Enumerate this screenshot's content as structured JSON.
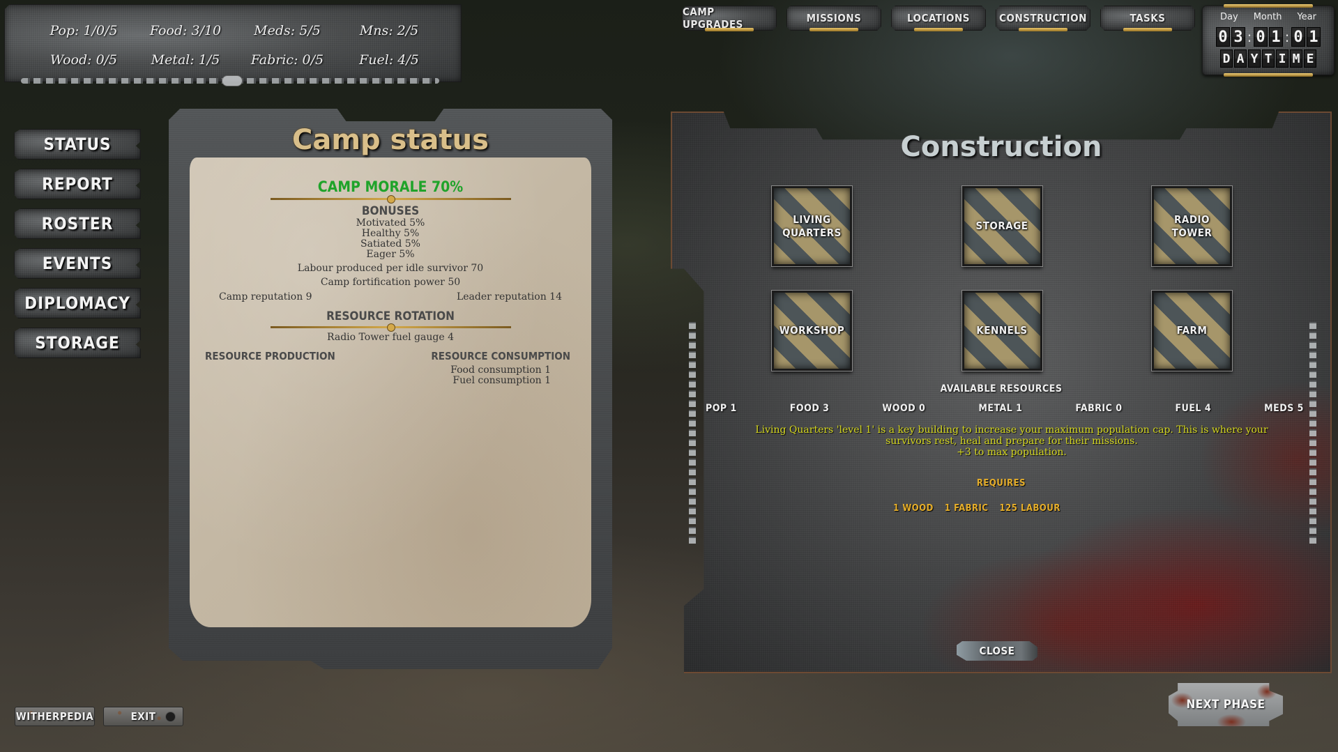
{
  "resource_bar": {
    "items": [
      {
        "label": "Pop: 1/0/5"
      },
      {
        "label": "Food: 3/10"
      },
      {
        "label": "Meds: 5/5"
      },
      {
        "label": "Mns: 2/5"
      },
      {
        "label": "Wood: 0/5"
      },
      {
        "label": "Metal: 1/5"
      },
      {
        "label": "Fabric: 0/5"
      },
      {
        "label": "Fuel: 4/5"
      }
    ]
  },
  "top_nav": {
    "tabs": [
      {
        "label": "Camp upgrades"
      },
      {
        "label": "Missions"
      },
      {
        "label": "Locations"
      },
      {
        "label": "Construction"
      },
      {
        "label": "Tasks"
      }
    ]
  },
  "clock": {
    "day_label": "Day",
    "month_label": "Month",
    "year_label": "Year",
    "day": "03",
    "month": "01",
    "year": "01",
    "phase": "DAYTIME"
  },
  "side_menu": {
    "items": [
      {
        "label": "Status"
      },
      {
        "label": "Report"
      },
      {
        "label": "Roster"
      },
      {
        "label": "Events"
      },
      {
        "label": "Diplomacy"
      },
      {
        "label": "Storage"
      }
    ]
  },
  "camp_status": {
    "title": "Camp status",
    "morale": "Camp Morale 70%",
    "bonuses_heading": "Bonuses",
    "bonuses": [
      "Motivated 5%",
      "Healthy 5%",
      "Satiated 5%",
      "Eager 5%"
    ],
    "labour": "Labour produced per idle survivor 70",
    "fortification": "Camp fortification power 50",
    "camp_reputation": "Camp reputation 9",
    "leader_reputation": "Leader reputation 14",
    "rotation_heading": "Resource Rotation",
    "radio_fuel": "Radio Tower fuel gauge 4",
    "production_heading": "Resource Production",
    "consumption_heading": "Resource Consumption",
    "consumption": [
      "Food consumption 1",
      "Fuel consumption 1"
    ]
  },
  "construction": {
    "title": "Construction",
    "buildings": [
      {
        "label": "Living Quarters"
      },
      {
        "label": "Storage"
      },
      {
        "label": "Radio Tower"
      },
      {
        "label": "Workshop"
      },
      {
        "label": "Kennels"
      },
      {
        "label": "Farm"
      }
    ],
    "available_heading": "Available Resources",
    "available": [
      "Pop 1",
      "Food 3",
      "Wood 0",
      "Metal 1",
      "Fabric 0",
      "Fuel 4",
      "Meds 5"
    ],
    "description": "Living Quarters 'level 1' is a key building to increase your maximum population cap. This is where your survivors rest, heal and prepare for their missions.",
    "effect": "+3 to max population.",
    "requires_heading": "Requires",
    "requires": [
      "1 Wood",
      "1 Fabric",
      "125 Labour"
    ],
    "close_label": "Close"
  },
  "bottom": {
    "witherpedia_label": "Witherpedia",
    "exit_label": "Exit",
    "next_phase_label": "Next Phase"
  },
  "colors": {
    "morale_green": "#1fa32a",
    "description_yellow": "#d6d820",
    "requires_orange": "#e6ae2a",
    "title_gold": "#d9bf8a"
  }
}
